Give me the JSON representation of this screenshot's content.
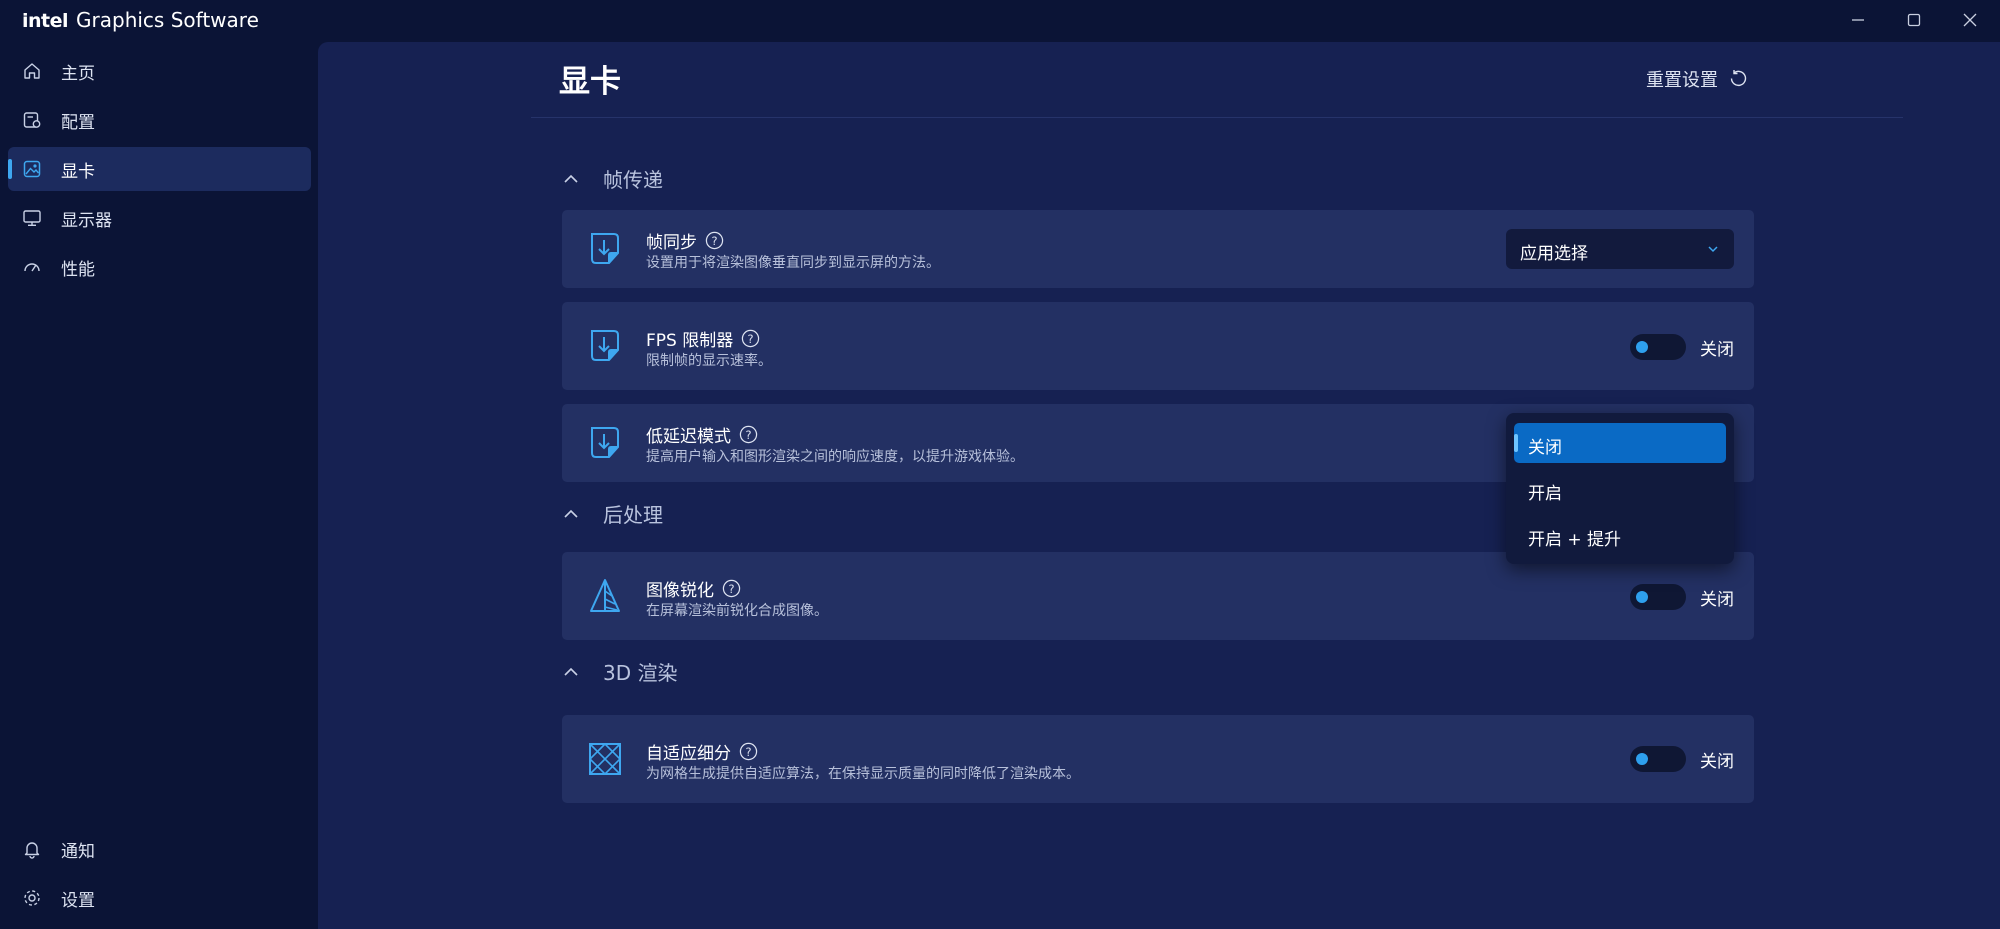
{
  "app": {
    "brand": "intel",
    "name": "Graphics Software"
  },
  "window_controls": {
    "minimize_icon": "minimize-icon",
    "maximize_icon": "maximize-icon",
    "close_icon": "close-icon"
  },
  "sidebar": {
    "items": [
      {
        "label": "主页",
        "icon": "home-icon"
      },
      {
        "label": "配置",
        "icon": "profile-icon"
      },
      {
        "label": "显卡",
        "icon": "graphics-icon",
        "active": true
      },
      {
        "label": "显示器",
        "icon": "monitor-icon"
      },
      {
        "label": "性能",
        "icon": "gauge-icon"
      }
    ],
    "bottom_items": [
      {
        "label": "通知",
        "icon": "bell-icon"
      },
      {
        "label": "设置",
        "icon": "gear-icon"
      }
    ]
  },
  "header": {
    "title": "显卡",
    "reset_label": "重置设置",
    "reset_icon": "reset-icon"
  },
  "sections": {
    "frame_delivery": {
      "title": "帧传递",
      "items": {
        "vsync": {
          "title": "帧同步",
          "description": "设置用于将渲染图像垂直同步到显示屏的方法。",
          "value": "应用选择"
        },
        "fps_limiter": {
          "title": "FPS 限制器",
          "description": "限制帧的显示速率。",
          "state": "关闭"
        },
        "low_latency": {
          "title": "低延迟模式",
          "description": "提高用户输入和图形渲染之间的响应速度，以提升游戏体验。"
        }
      }
    },
    "post_processing": {
      "title": "后处理",
      "items": {
        "sharpening": {
          "title": "图像锐化",
          "description": "在屏幕渲染前锐化合成图像。",
          "state": "关闭"
        }
      }
    },
    "rendering_3d": {
      "title": "3D 渲染",
      "items": {
        "tessellation": {
          "title": "自适应细分",
          "description": "为网格生成提供自适应算法，在保持显示质量的同时降低了渲染成本。",
          "state": "关闭"
        }
      }
    }
  },
  "low_latency_dropdown": {
    "options": [
      "关闭",
      "开启",
      "开启 + 提升"
    ],
    "selected": "关闭"
  },
  "colors": {
    "accent": "#3ea7f0",
    "selection": "#0a6ac5",
    "background": "#0b1436",
    "panel": "#162152",
    "card": "#233063"
  }
}
